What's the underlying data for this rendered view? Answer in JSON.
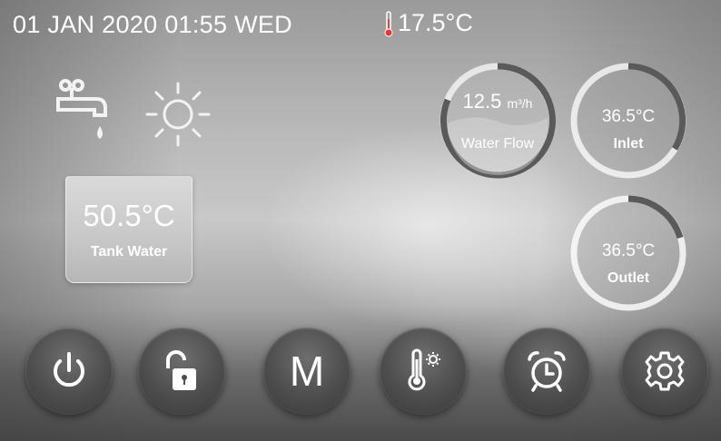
{
  "status_bar": {
    "datetime": "01 JAN 2020 01:55 WED",
    "ambient_temp": "17.5°C",
    "thermometer_icon": "thermometer-icon"
  },
  "mode_icons": {
    "hot_water_icon": "tap-icon",
    "heating_icon": "sun-icon"
  },
  "tank": {
    "temp": "50.5°C",
    "label": "Tank Water"
  },
  "gauges": {
    "flow": {
      "value": "12.5",
      "unit": "m³/h",
      "label": "Water Flow"
    },
    "inlet": {
      "value": "36.5°C",
      "label": "Inlet"
    },
    "outlet": {
      "value": "36.5°C",
      "label": "Outlet"
    }
  },
  "buttons": {
    "power": "power-icon",
    "lock": "unlock-icon",
    "mode_letter": "M",
    "temp_settings": "thermometer-gear-icon",
    "timer": "alarm-clock-icon",
    "settings": "gear-icon"
  },
  "colors": {
    "text": "#ffffff",
    "button": "#4d4d4d"
  }
}
